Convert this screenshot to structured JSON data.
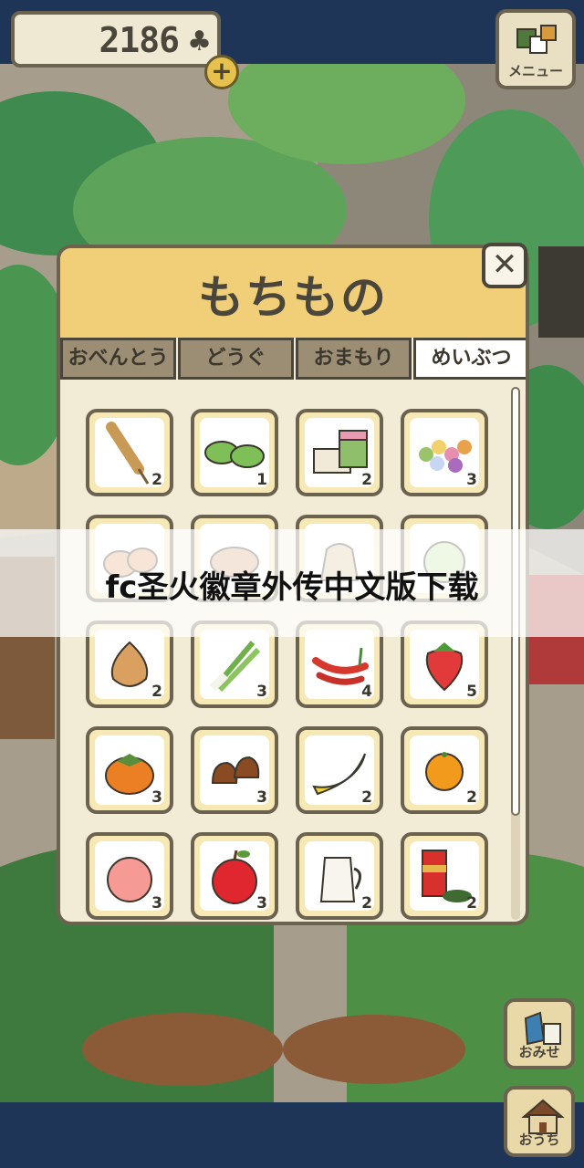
{
  "hud": {
    "clover_count": "2186",
    "clover_symbol": "♣",
    "add_symbol": "+",
    "menu_label": "メニュー"
  },
  "inventory": {
    "title": "もちもの",
    "close_symbol": "✕",
    "tabs": [
      {
        "label": "おべんとう",
        "active": false
      },
      {
        "label": "どうぐ",
        "active": false
      },
      {
        "label": "おまもり",
        "active": false
      },
      {
        "label": "めいぶつ",
        "active": true
      }
    ],
    "items": [
      {
        "icon": "corn-dog-icon",
        "count": "2"
      },
      {
        "icon": "green-mochi-icon",
        "count": "1"
      },
      {
        "icon": "layered-mochi-icon",
        "count": "2"
      },
      {
        "icon": "dango-icon",
        "count": "3"
      },
      {
        "icon": "manju-icon",
        "count": ""
      },
      {
        "icon": "bun-icon",
        "count": ""
      },
      {
        "icon": "sack-icon",
        "count": ""
      },
      {
        "icon": "cabbage-icon",
        "count": ""
      },
      {
        "icon": "onion-icon",
        "count": "2"
      },
      {
        "icon": "green-onion-icon",
        "count": "3"
      },
      {
        "icon": "chili-pepper-icon",
        "count": "4"
      },
      {
        "icon": "strawberry-icon",
        "count": "5"
      },
      {
        "icon": "persimmon-icon",
        "count": "3"
      },
      {
        "icon": "chestnut-icon",
        "count": "3"
      },
      {
        "icon": "banana-icon",
        "count": "2"
      },
      {
        "icon": "orange-icon",
        "count": "2"
      },
      {
        "icon": "peach-icon",
        "count": "3"
      },
      {
        "icon": "apple-icon",
        "count": "3"
      },
      {
        "icon": "milk-jug-icon",
        "count": "2"
      },
      {
        "icon": "tea-can-icon",
        "count": "2"
      }
    ]
  },
  "side_buttons": {
    "shop_label": "おみせ",
    "home_label": "おうち"
  },
  "banner": {
    "text": "fc圣火徽章外传中文版下载"
  }
}
